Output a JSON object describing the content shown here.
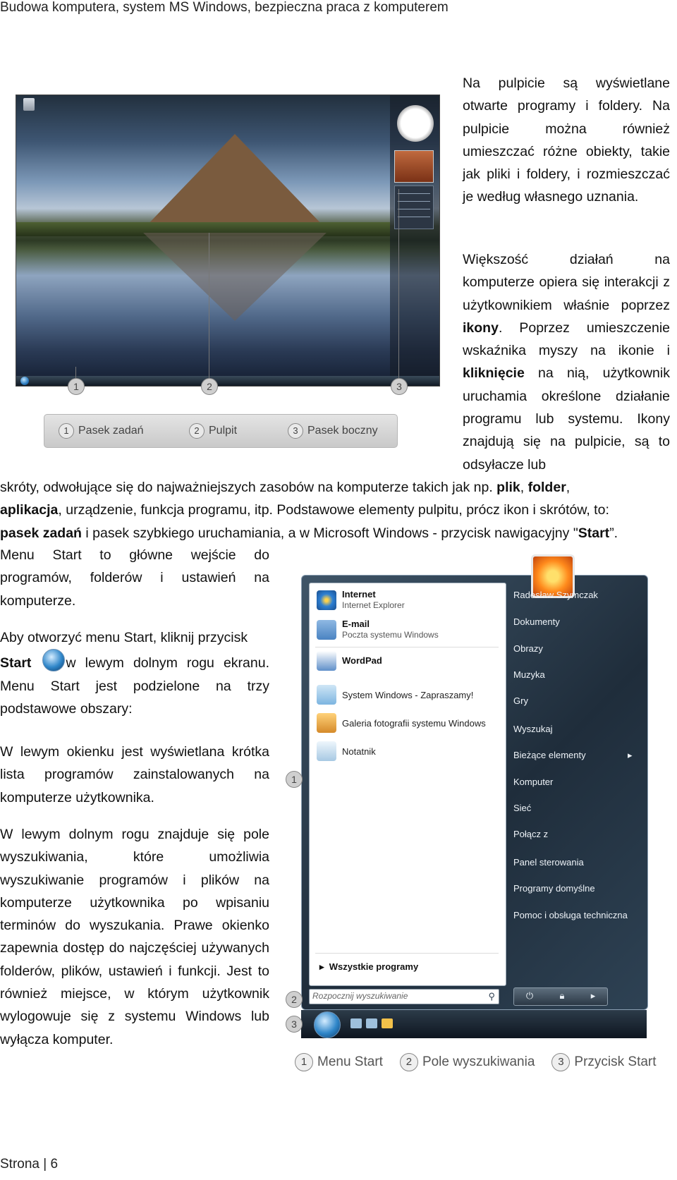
{
  "header": "Budowa komputera, system MS Windows, bezpieczna praca z komputerem",
  "footer": "Strona | 6",
  "intro": {
    "p1": "Na pulpicie są wyświetlane otwarte programy i foldery. Na pulpicie można również umieszczać różne obiekty, takie jak pliki i foldery, i rozmieszczać je według własnego uznania.",
    "p2_a": "Większość działań na komputerze opiera się interakcji z użytkownikiem właśnie poprzez ",
    "p2_b": "ikony",
    "p2_c": ". Poprzez umieszczenie wskaźnika myszy na ikonie i ",
    "p2_d": "kliknięcie",
    "p2_e": " na nią, użytkownik uruchamia określone działanie programu lub systemu. Ikony znajdują się na pulpicie, są to odsyłacze lub",
    "p3_a": "skróty, odwołujące się do najważniejszych zasobów na komputerze takich jak np. ",
    "p3_b": "plik",
    "p3_c": ", ",
    "p3_d": "folder",
    "p3_e": ",",
    "p3_f": "aplikacja",
    "p3_g": ", urządzenie, funkcja programu, itp. Podstawowe elementy pulpitu, prócz ikon i skrótów, to:",
    "p3_h": "pasek zadań",
    "p3_i": " i pasek szybkiego uruchamiania, a w Microsoft Windows - przycisk nawigacyjny \"",
    "p3_j": "Start",
    "p3_k": "”."
  },
  "left_col": {
    "p1": "Menu Start to główne wejście do programów, folderów i ustawień na komputerze.",
    "p2_a": "Aby otworzyć menu Start, kliknij przycisk",
    "p2_b": "Start",
    "p2_c": "w lewym dolnym rogu ekranu. Menu Start jest podzielone na trzy podstawowe obszary:",
    "p3": "W lewym okienku jest wyświetlana krótka lista programów zainstalowanych na komputerze użytkownika.",
    "p4": "W lewym dolnym rogu znajduje się pole wyszukiwania, które umożliwia wyszukiwanie programów i plików na komputerze użytkownika po wpisaniu terminów do wyszukania. Prawe okienko zapewnia dostęp do najczęściej używanych folderów, plików, ustawień i funkcji. Jest to również miejsce, w którym użytkownik wylogowuje się z systemu Windows lub wyłącza komputer."
  },
  "desktop_figure": {
    "callouts": [
      "1",
      "2",
      "3"
    ],
    "legend": [
      {
        "num": "1",
        "label": "Pasek zadań"
      },
      {
        "num": "2",
        "label": "Pulpit"
      },
      {
        "num": "3",
        "label": "Pasek boczny"
      }
    ]
  },
  "start_menu": {
    "pinned": [
      {
        "title": "Internet",
        "sub": "Internet Explorer",
        "color": "#2d7fd3"
      },
      {
        "title": "E-mail",
        "sub": "Poczta systemu Windows",
        "color": "#4a83c2"
      }
    ],
    "recent": [
      {
        "label": "WordPad",
        "color": "#5f8fc9",
        "bold": true
      },
      {
        "label": "System Windows - Zapraszamy!",
        "color": "#7db5e0"
      },
      {
        "label": "Galeria fotografii systemu Windows",
        "color": "#d58a2a"
      },
      {
        "label": "Notatnik",
        "color": "#a7c9e3"
      }
    ],
    "all_programs": "Wszystkie programy",
    "search_placeholder": "Rozpocznij wyszukiwanie",
    "right_items": [
      "Radosław Szymczak",
      "Dokumenty",
      "Obrazy",
      "Muzyka",
      "Gry",
      "Wyszukaj",
      "Bieżące elementy",
      "Komputer",
      "Sieć",
      "Połącz z",
      "Panel sterowania",
      "Programy domyślne",
      "Pomoc i obsługa techniczna"
    ],
    "callouts": [
      "1",
      "2",
      "3"
    ],
    "legend": [
      {
        "num": "1",
        "label": "Menu Start"
      },
      {
        "num": "2",
        "label": "Pole wyszukiwania"
      },
      {
        "num": "3",
        "label": "Przycisk Start"
      }
    ]
  }
}
